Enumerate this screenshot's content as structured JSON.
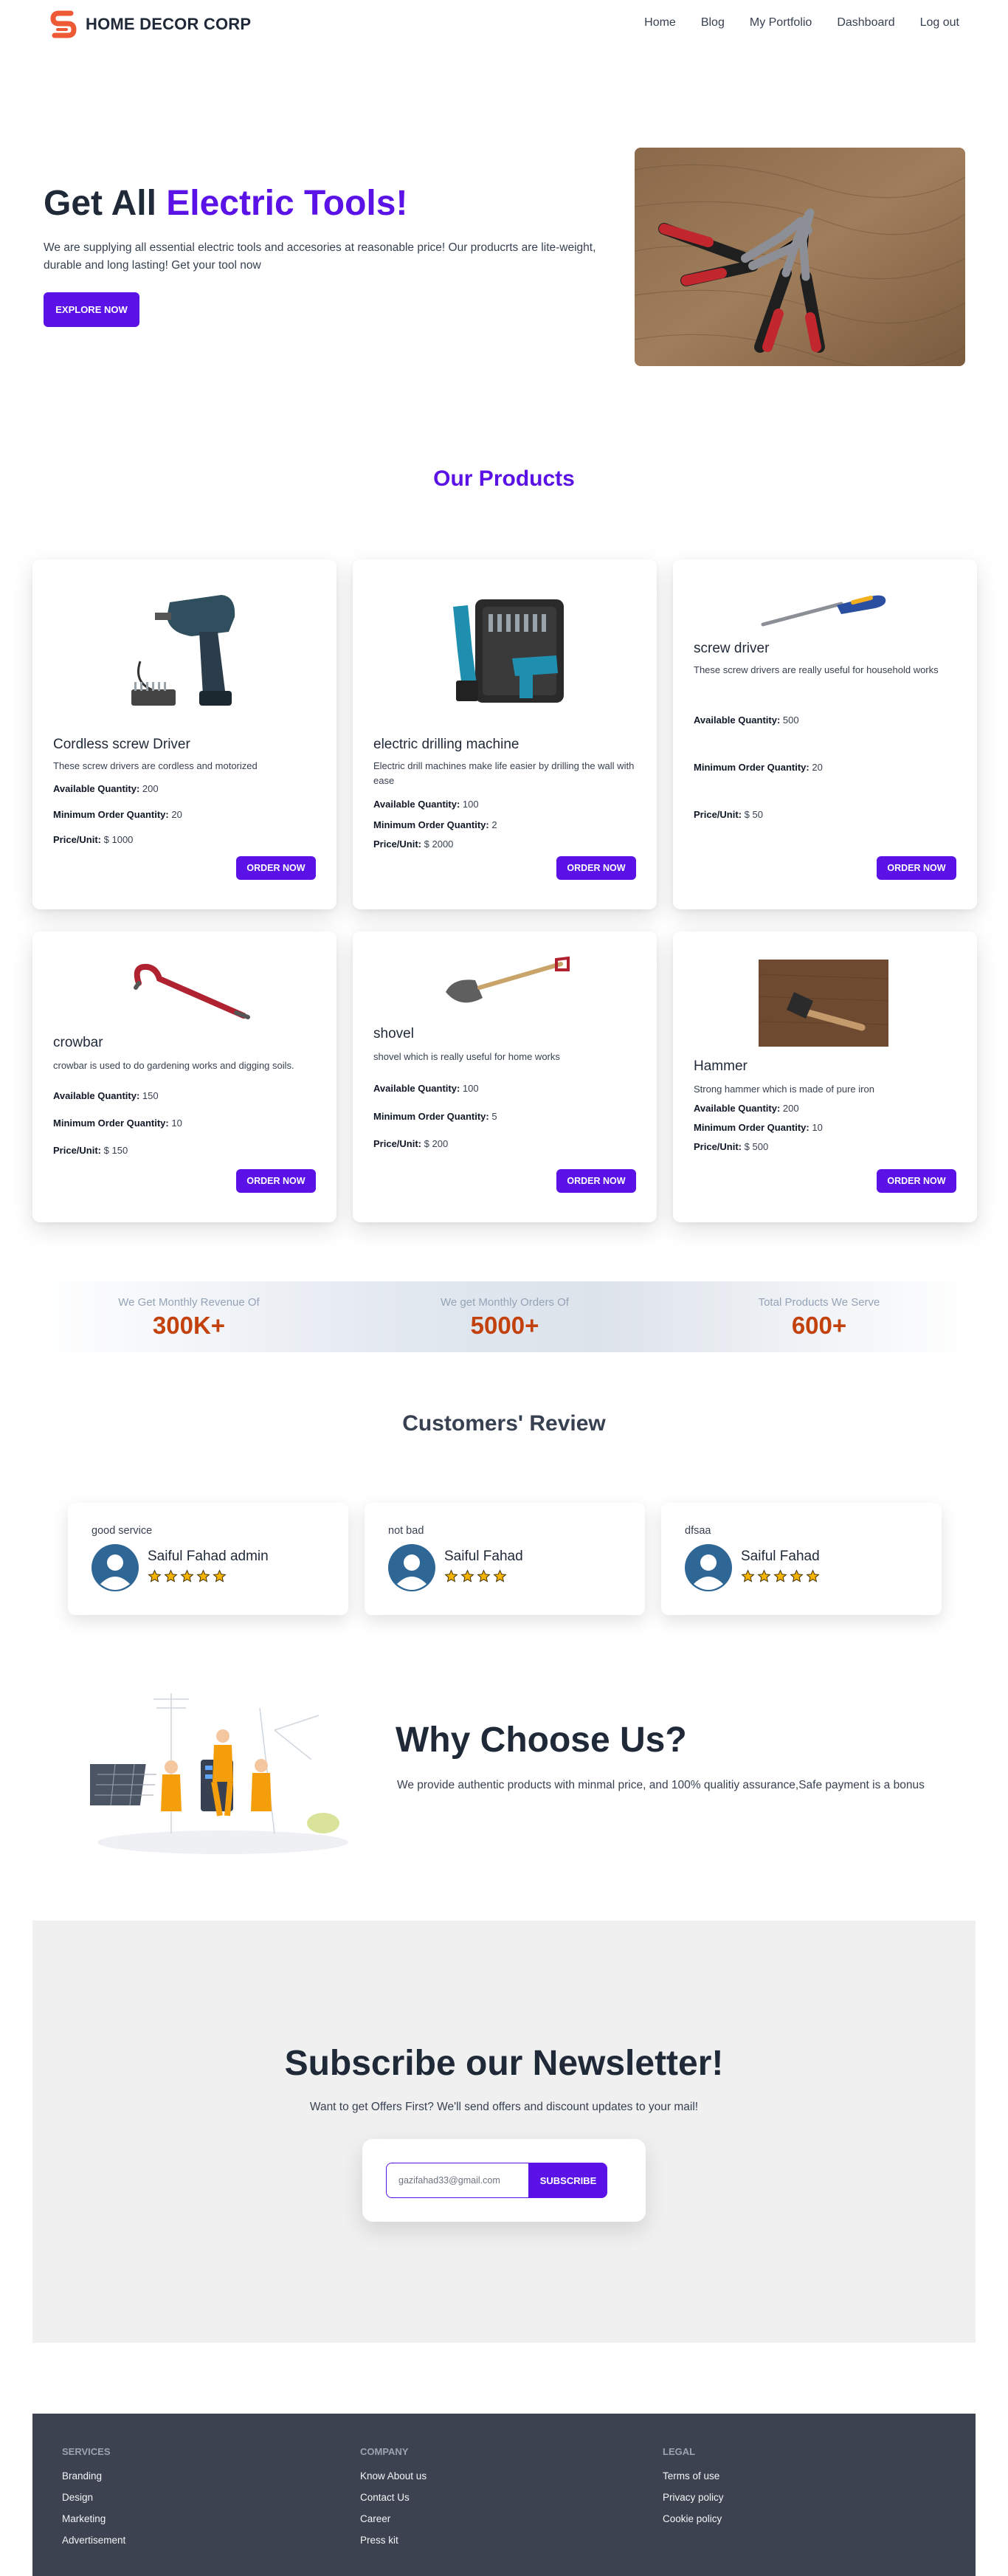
{
  "nav": {
    "brand": "HOME DECOR CORP",
    "links": [
      "Home",
      "Blog",
      "My Portfolio",
      "Dashboard",
      "Log out"
    ]
  },
  "hero": {
    "title_prefix": "Get All ",
    "title_accent": "Electric Tools!",
    "description": "We are supplying all essential electric tools and accesories at reasonable price! Our producrts are lite-weight, durable and long lasting! Get your tool now",
    "button": "EXPLORE NOW"
  },
  "products": {
    "title": "Our Products",
    "qty_label": "Available Quantity:",
    "min_label": "Minimum Order Quantity:",
    "price_label": "Price/Unit:",
    "order_button": "ORDER NOW",
    "items": [
      {
        "name": "Cordless screw Driver",
        "description": "These screw drivers are cordless and motorized",
        "available": "200",
        "minimum": "20",
        "price": "$ 1000"
      },
      {
        "name": "electric drilling machine",
        "description": "Electric drill machines make life easier by drilling the wall with ease",
        "available": "100",
        "minimum": "2",
        "price": "$ 2000"
      },
      {
        "name": "screw driver",
        "description": "These screw drivers are really useful for household works",
        "available": "500",
        "minimum": "20",
        "price": "$ 50"
      },
      {
        "name": "crowbar",
        "description": "crowbar is used to do gardening works and digging soils.",
        "available": "150",
        "minimum": "10",
        "price": "$ 150"
      },
      {
        "name": "shovel",
        "description": "shovel which is really useful for home works",
        "available": "100",
        "minimum": "5",
        "price": "$ 200"
      },
      {
        "name": "Hammer",
        "description": "Strong hammer which is made of pure iron",
        "available": "200",
        "minimum": "10",
        "price": "$ 500"
      }
    ]
  },
  "stats": [
    {
      "label": "We Get Monthly Revenue Of",
      "value": "300K+"
    },
    {
      "label": "We get Monthly Orders Of",
      "value": "5000+"
    },
    {
      "label": "Total Products We Serve",
      "value": "600+"
    }
  ],
  "reviews": {
    "title": "Customers' Review",
    "items": [
      {
        "text": "good service",
        "name": "Saiful Fahad admin",
        "rating": 5
      },
      {
        "text": "not bad",
        "name": "Saiful Fahad",
        "rating": 4
      },
      {
        "text": "dfsaa",
        "name": "Saiful Fahad",
        "rating": 5
      }
    ]
  },
  "why": {
    "title": "Why Choose Us?",
    "description": "We provide authentic products with minmal price, and 100% qualitiy assurance,Safe payment is a bonus"
  },
  "newsletter": {
    "title": "Subscribe our Newsletter!",
    "subtitle": "Want to get Offers First? We'll send offers and discount updates to your mail!",
    "input_value": "gazifahad33@gmail.com",
    "button": "SUBSCRIBE"
  },
  "footer": {
    "columns": [
      {
        "heading": "SERVICES",
        "links": [
          "Branding",
          "Design",
          "Marketing",
          "Advertisement"
        ]
      },
      {
        "heading": "COMPANY",
        "links": [
          "Know About us",
          "Contact Us",
          "Career",
          "Press kit"
        ]
      },
      {
        "heading": "LEGAL",
        "links": [
          "Terms of use",
          "Privacy policy",
          "Cookie policy"
        ]
      }
    ]
  },
  "colors": {
    "accent": "#5b12e6",
    "stat_value": "#c2410c",
    "footer_bg": "#3d4250",
    "newsletter_bg": "#f0f0f0"
  },
  "icons": [
    "brand-logo-icon",
    "tool-illustrations",
    "user-avatar-icon",
    "star-icon"
  ]
}
